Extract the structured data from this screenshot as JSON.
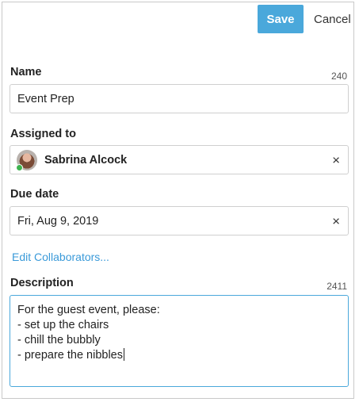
{
  "toolbar": {
    "save_label": "Save",
    "cancel_label": "Cancel"
  },
  "name": {
    "label": "Name",
    "counter": "240",
    "value": "Event Prep"
  },
  "assigned_to": {
    "label": "Assigned to",
    "assignee": "Sabrina Alcock",
    "status": "online",
    "clear_icon": "×"
  },
  "due_date": {
    "label": "Due date",
    "value": "Fri, Aug 9, 2019",
    "clear_icon": "×"
  },
  "collaborators": {
    "link_label": "Edit Collaborators..."
  },
  "description": {
    "label": "Description",
    "counter": "2411",
    "lines": [
      "For the guest event, please:",
      "- set up the chairs",
      "- chill the bubbly",
      "- prepare the nibbles"
    ]
  },
  "colors": {
    "accent": "#4aa8db",
    "link": "#3a9ad9",
    "status_online": "#3fb34f"
  }
}
